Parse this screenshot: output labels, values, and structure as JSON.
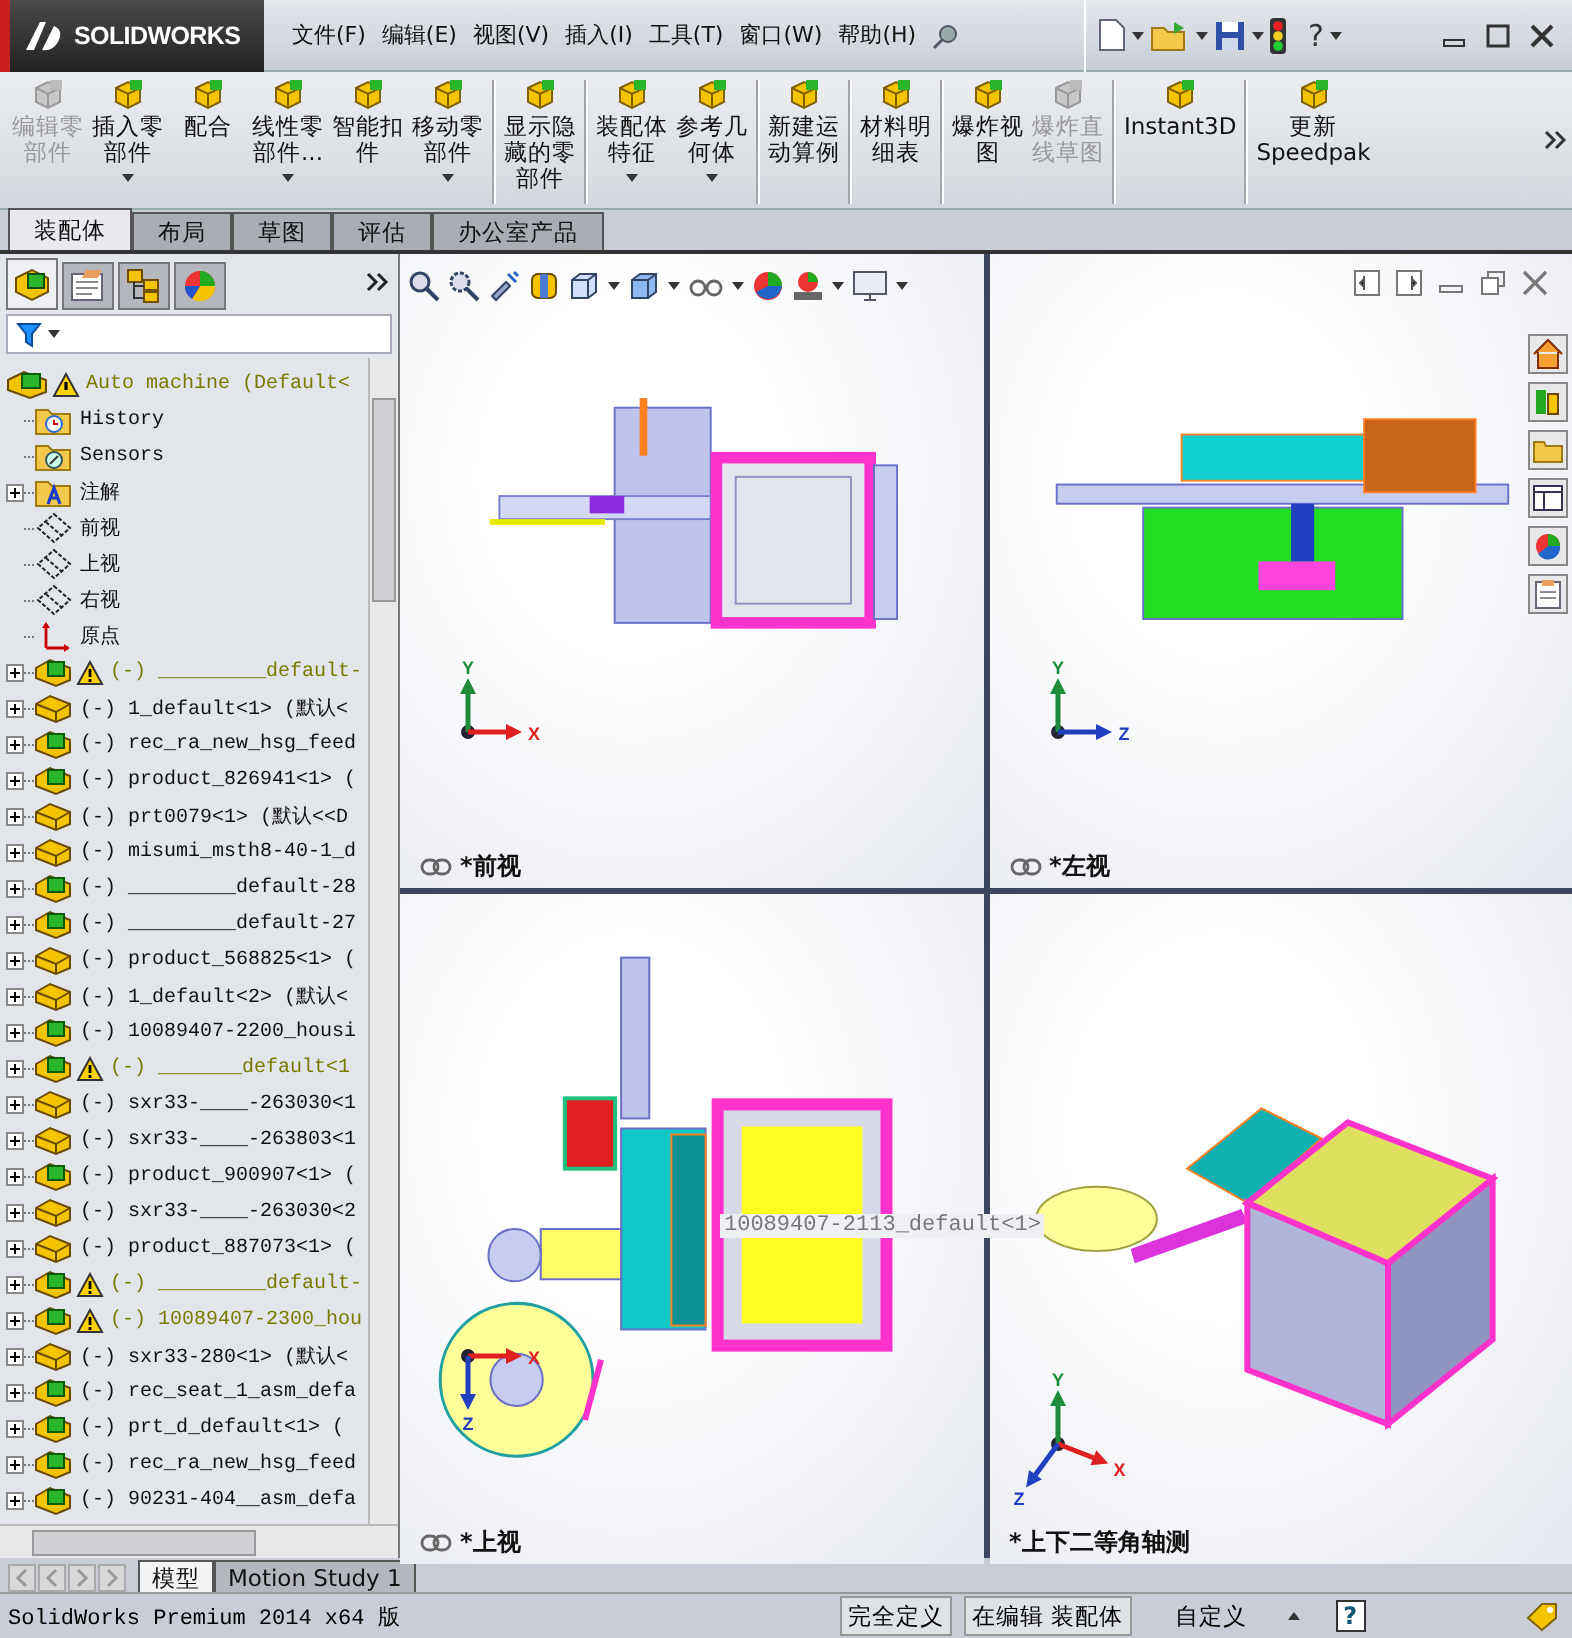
{
  "app": {
    "logo": "SOLIDWORKS",
    "help": "?"
  },
  "menu": [
    "文件(F)",
    "编辑(E)",
    "视图(V)",
    "插入(I)",
    "工具(T)",
    "窗口(W)",
    "帮助(H)"
  ],
  "command_groups": [
    [
      {
        "lines": [
          "编辑零",
          "部件"
        ],
        "disabled": true,
        "dropdown": false
      },
      {
        "lines": [
          "插入零",
          "部件"
        ],
        "disabled": false,
        "dropdown": true
      },
      {
        "lines": [
          "配合"
        ],
        "disabled": false,
        "dropdown": false
      },
      {
        "lines": [
          "线性零",
          "部件..."
        ],
        "disabled": false,
        "dropdown": true
      },
      {
        "lines": [
          "智能扣",
          "件"
        ],
        "disabled": false,
        "dropdown": false
      },
      {
        "lines": [
          "移动零",
          "部件"
        ],
        "disabled": false,
        "dropdown": true
      }
    ],
    [
      {
        "lines": [
          "显示隐",
          "藏的零",
          "部件"
        ],
        "disabled": false,
        "dropdown": false
      }
    ],
    [
      {
        "lines": [
          "装配体",
          "特征"
        ],
        "disabled": false,
        "dropdown": true
      },
      {
        "lines": [
          "参考几",
          "何体"
        ],
        "disabled": false,
        "dropdown": true
      }
    ],
    [
      {
        "lines": [
          "新建运",
          "动算例"
        ],
        "disabled": false,
        "dropdown": false
      }
    ],
    [
      {
        "lines": [
          "材料明",
          "细表"
        ],
        "disabled": false,
        "dropdown": false
      }
    ],
    [
      {
        "lines": [
          "爆炸视",
          "图"
        ],
        "disabled": false,
        "dropdown": false
      },
      {
        "lines": [
          "爆炸直",
          "线草图"
        ],
        "disabled": true,
        "dropdown": false
      }
    ],
    [
      {
        "lines": [
          "Instant3D"
        ],
        "disabled": false,
        "dropdown": false
      }
    ],
    [
      {
        "lines": [
          "更新",
          "Speedpak"
        ],
        "disabled": false,
        "dropdown": false
      }
    ]
  ],
  "tabs": [
    {
      "label": "装配体",
      "selected": true
    },
    {
      "label": "布局",
      "selected": false
    },
    {
      "label": "草图",
      "selected": false
    },
    {
      "label": "评估",
      "selected": false
    },
    {
      "label": "办公室产品",
      "selected": false
    }
  ],
  "panel_tabs": [
    {
      "kind": "tree",
      "selected": true
    },
    {
      "kind": "properties",
      "selected": false
    },
    {
      "kind": "configurations",
      "selected": false
    },
    {
      "kind": "display",
      "selected": false
    }
  ],
  "tree": {
    "label": "Auto machine  (Default<",
    "kind": "assembly",
    "warning": true,
    "children": [
      {
        "label": "History",
        "kind": "history",
        "expandable": false,
        "warning": false
      },
      {
        "label": "Sensors",
        "kind": "sensors",
        "expandable": false,
        "warning": false
      },
      {
        "label": "注解",
        "kind": "annotations",
        "expandable": true,
        "warning": false
      },
      {
        "label": "前视",
        "kind": "plane",
        "expandable": false,
        "warning": false
      },
      {
        "label": "上视",
        "kind": "plane",
        "expandable": false,
        "warning": false
      },
      {
        "label": "右视",
        "kind": "plane",
        "expandable": false,
        "warning": false
      },
      {
        "label": "原点",
        "kind": "origin",
        "expandable": false,
        "warning": false
      },
      {
        "label": "(-) _________default-",
        "kind": "assembly",
        "expandable": true,
        "warning": true
      },
      {
        "label": "(-) 1_default<1> (默认<",
        "kind": "part",
        "expandable": true,
        "warning": false
      },
      {
        "label": "(-) rec_ra_new_hsg_feed",
        "kind": "assembly",
        "expandable": true,
        "warning": false
      },
      {
        "label": "(-) product_826941<1> (",
        "kind": "assembly",
        "expandable": true,
        "warning": false
      },
      {
        "label": "(-) prt0079<1> (默认<<D",
        "kind": "part",
        "expandable": true,
        "warning": false
      },
      {
        "label": "(-) misumi_msth8-40-1_d",
        "kind": "part",
        "expandable": true,
        "warning": false
      },
      {
        "label": "(-) _________default-28",
        "kind": "assembly",
        "expandable": true,
        "warning": false
      },
      {
        "label": "(-) _________default-27",
        "kind": "assembly",
        "expandable": true,
        "warning": false
      },
      {
        "label": "(-) product_568825<1> (",
        "kind": "part",
        "expandable": true,
        "warning": false
      },
      {
        "label": "(-) 1_default<2> (默认<",
        "kind": "part",
        "expandable": true,
        "warning": false
      },
      {
        "label": "(-) 10089407-2200_housi",
        "kind": "assembly",
        "expandable": true,
        "warning": false
      },
      {
        "label": "(-) _______default<1",
        "kind": "assembly",
        "expandable": true,
        "warning": true
      },
      {
        "label": "(-) sxr33-____-263030<1",
        "kind": "part",
        "expandable": true,
        "warning": false
      },
      {
        "label": "(-) sxr33-____-263803<1",
        "kind": "part",
        "expandable": true,
        "warning": false
      },
      {
        "label": "(-) product_900907<1> (",
        "kind": "assembly",
        "expandable": true,
        "warning": false
      },
      {
        "label": "(-) sxr33-____-263030<2",
        "kind": "part",
        "expandable": true,
        "warning": false
      },
      {
        "label": "(-) product_887073<1> (",
        "kind": "part",
        "expandable": true,
        "warning": false
      },
      {
        "label": "(-) _________default-",
        "kind": "assembly",
        "expandable": true,
        "warning": true
      },
      {
        "label": "(-) 10089407-2300_hou",
        "kind": "assembly",
        "expandable": true,
        "warning": true
      },
      {
        "label": "(-) sxr33-280<1> (默认<",
        "kind": "part",
        "expandable": true,
        "warning": false
      },
      {
        "label": "(-) rec_seat_1_asm_defa",
        "kind": "assembly",
        "expandable": true,
        "warning": false
      },
      {
        "label": "(-) prt_d_default<1> (",
        "kind": "assembly",
        "expandable": true,
        "warning": false
      },
      {
        "label": "(-) rec_ra_new_hsg_feed",
        "kind": "assembly",
        "expandable": true,
        "warning": false
      },
      {
        "label": "(-) 90231-404__asm_defa",
        "kind": "assembly",
        "expandable": true,
        "warning": false
      }
    ]
  },
  "viewports": [
    {
      "label": "*前视",
      "kind": "front",
      "linked": true,
      "axes": [
        {
          "label": "Y",
          "kind": "up",
          "color": "#1e8c3a"
        },
        {
          "label": "X",
          "kind": "right",
          "color": "#e02020"
        }
      ]
    },
    {
      "label": "*左视",
      "kind": "left",
      "linked": true,
      "axes": [
        {
          "label": "Y",
          "kind": "up",
          "color": "#1e8c3a"
        },
        {
          "label": "Z",
          "kind": "right",
          "color": "#2040c0"
        }
      ]
    },
    {
      "label": "*上视",
      "kind": "top",
      "linked": true,
      "axes": [
        {
          "label": "X",
          "kind": "right",
          "color": "#e02020"
        },
        {
          "label": "Z",
          "kind": "down",
          "color": "#2040c0"
        }
      ]
    },
    {
      "label": "*上下二等角轴测",
      "kind": "iso",
      "linked": false,
      "axes": [
        {
          "label": "Y",
          "kind": "up",
          "color": "#1e8c3a"
        },
        {
          "label": "X",
          "kind": "downright",
          "color": "#e02020"
        },
        {
          "label": "Z",
          "kind": "downleft",
          "color": "#2040c0"
        }
      ]
    }
  ],
  "drag_label": "10089407-2113_default<1>",
  "bottom_tabs": [
    {
      "label": "模型",
      "selected": true
    },
    {
      "label": "Motion Study 1",
      "selected": false
    }
  ],
  "status_bar": {
    "product": "SolidWorks Premium 2014 x64 版",
    "state": "完全定义",
    "mode": "在编辑 装配体",
    "units": "自定义",
    "help": "?"
  }
}
